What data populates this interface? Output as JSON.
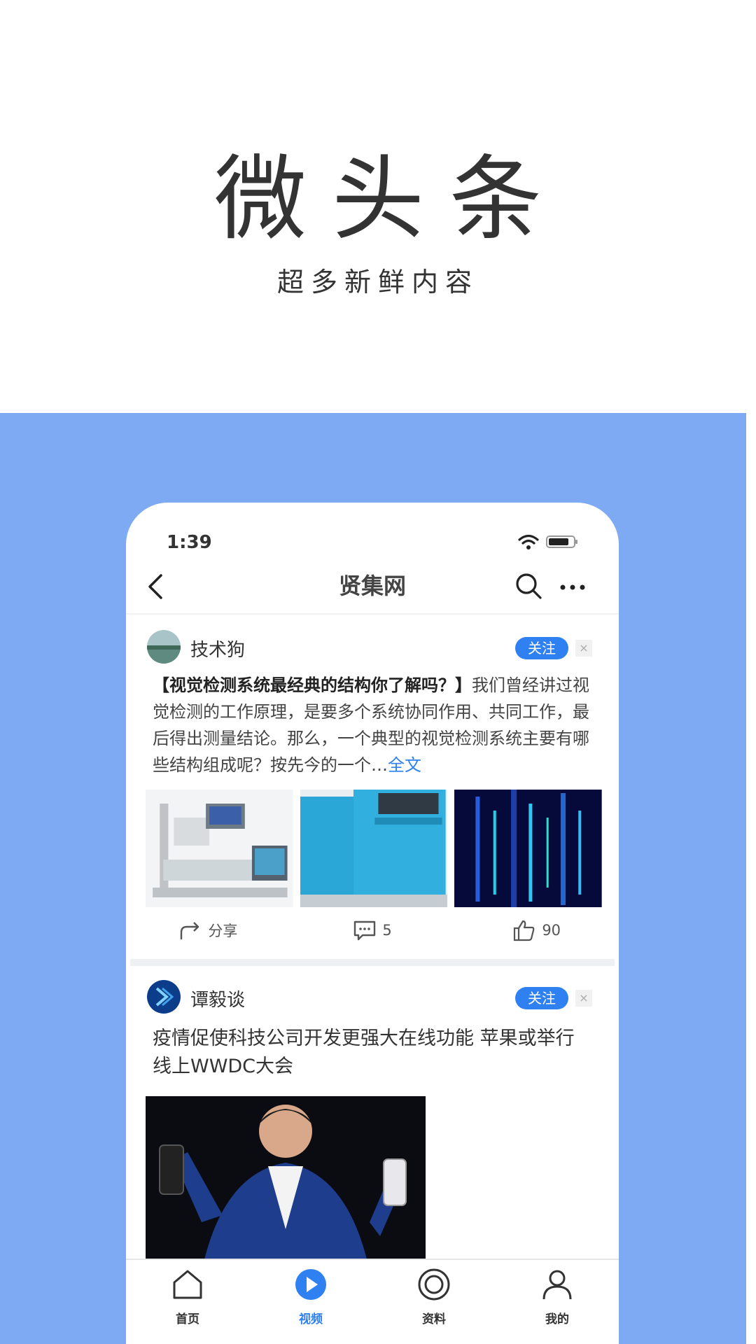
{
  "hero": {
    "title": "微头条",
    "subtitle": "超多新鲜内容"
  },
  "status_bar": {
    "time": "1:39"
  },
  "nav": {
    "title": "贤集网",
    "back_icon": "chevron-left-icon",
    "search_icon": "search-icon",
    "more_icon": "more-icon"
  },
  "posts": [
    {
      "author": "技术狗",
      "follow_label": "关注",
      "close_label": "×",
      "headline": "【视觉检测系统最经典的结构你了解吗？】",
      "body": "我们曾经讲过视觉检测的工作原理，是要多个系统协同作用、共同工作，最后得出测量结论。那么，一个典型的视觉检测系统主要有哪些结构组成呢？按先今的一个…",
      "read_more": "全文",
      "share_label": "分享",
      "comments": "5",
      "likes": "90"
    },
    {
      "author": "谭毅谈",
      "follow_label": "关注",
      "close_label": "×",
      "title": "疫情促使科技公司开发更强大在线功能  苹果或举行线上WWDC大会"
    }
  ],
  "tabs": [
    {
      "label": "首页",
      "icon": "home-icon"
    },
    {
      "label": "视频",
      "icon": "play-icon",
      "active": true
    },
    {
      "label": "资料",
      "icon": "circle-icon"
    },
    {
      "label": "我的",
      "icon": "user-icon"
    }
  ],
  "colors": {
    "accent": "#2f80f0",
    "background": "#7eaaf3"
  }
}
